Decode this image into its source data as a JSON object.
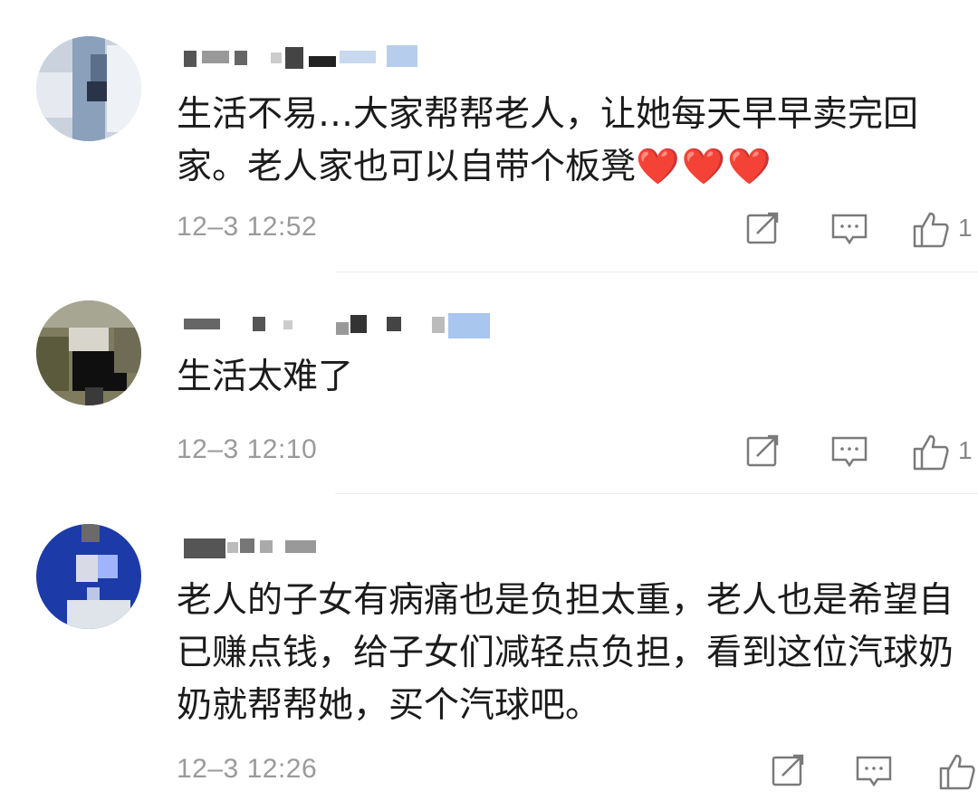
{
  "comments": [
    {
      "text": "生活不易…大家帮帮老人，让她每天早早卖完回家。老人家也可以自带个板凳",
      "emoji": "❤️❤️❤️",
      "time": "12–3 12:52",
      "likes": "1",
      "icons": [
        "share-icon",
        "comment-icon",
        "like-icon"
      ]
    },
    {
      "text": "生活太难了",
      "emoji": "",
      "time": "12–3 12:10",
      "likes": "1",
      "icons": [
        "share-icon",
        "comment-icon",
        "like-icon"
      ]
    },
    {
      "text": "老人的子女有病痛也是负担太重，老人也是希望自已赚点钱，给子女们减轻点负担，看到这位汽球奶奶就帮帮她，买个汽球吧。",
      "emoji": "",
      "time": "12–3 12:26",
      "likes": "",
      "icons": [
        "share-icon",
        "comment-icon",
        "like-icon"
      ]
    }
  ],
  "colors": {
    "text": "#1b1b1b",
    "meta": "#9a9a9a",
    "heart": "#e53935",
    "divider": "#ececec"
  }
}
